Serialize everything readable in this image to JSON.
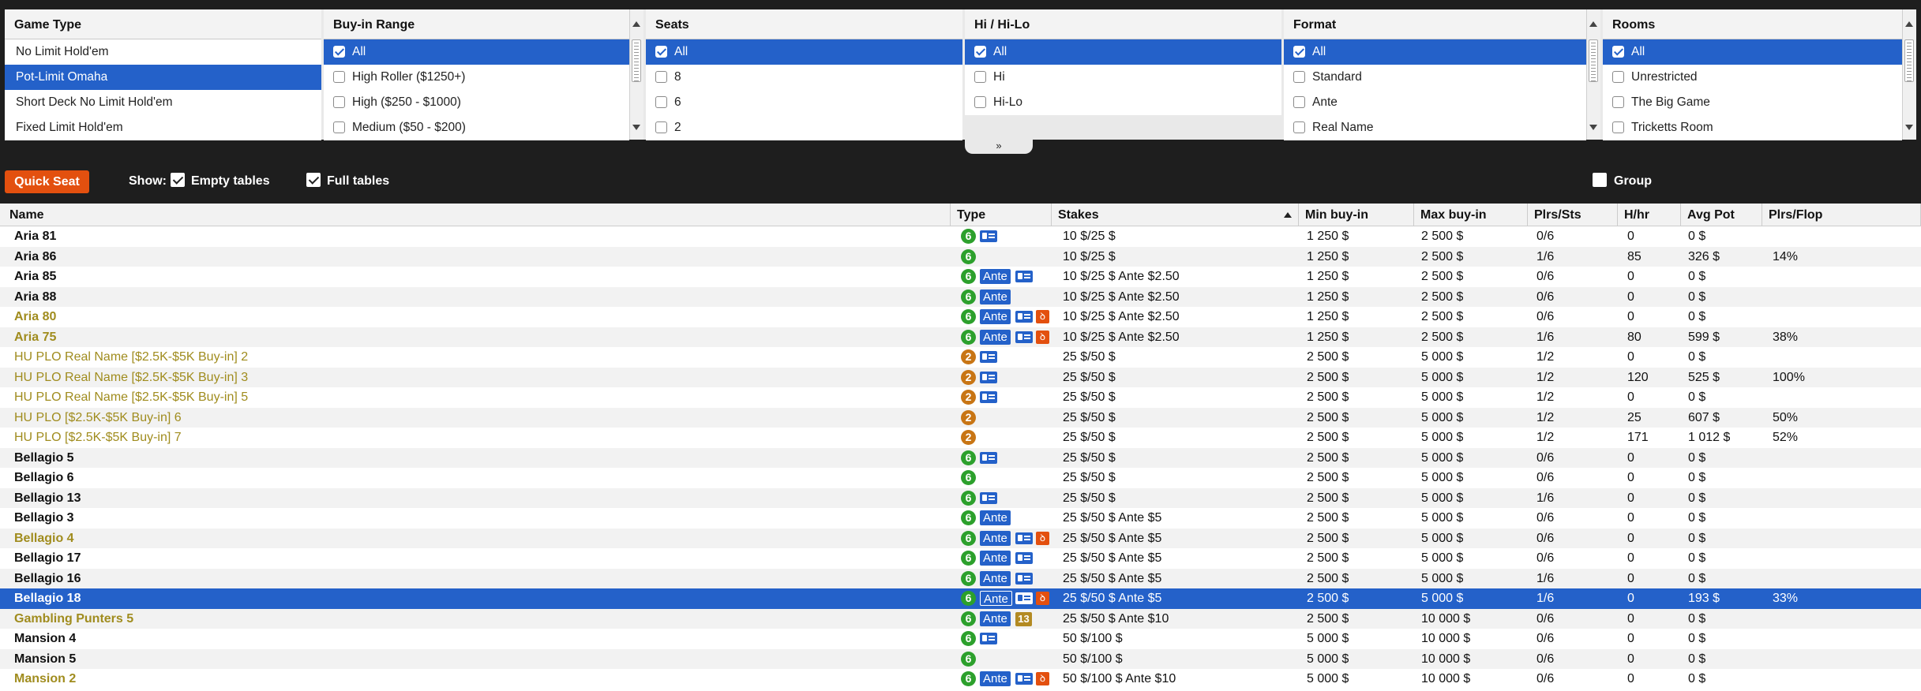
{
  "filters": {
    "game_type": {
      "title": "Game Type",
      "options": [
        "No Limit Hold'em",
        "Pot-Limit Omaha",
        "Short Deck No Limit Hold'em",
        "Fixed Limit Hold'em"
      ],
      "selected": 1
    },
    "buyin": {
      "title": "Buy-in Range",
      "options": [
        "All",
        "High Roller ($1250+)",
        "High ($250 - $1000)",
        "Medium ($50 - $200)"
      ],
      "checked": [
        true,
        false,
        false,
        false
      ]
    },
    "seats": {
      "title": "Seats",
      "options": [
        "All",
        "8",
        "6",
        "2"
      ],
      "checked": [
        true,
        false,
        false,
        false
      ]
    },
    "hilo": {
      "title": "Hi / Hi-Lo",
      "options": [
        "All",
        "Hi",
        "Hi-Lo"
      ],
      "checked": [
        true,
        false,
        false
      ]
    },
    "format": {
      "title": "Format",
      "options": [
        "All",
        "Standard",
        "Ante",
        "Real Name"
      ],
      "checked": [
        true,
        false,
        false,
        false
      ]
    },
    "rooms": {
      "title": "Rooms",
      "options": [
        "All",
        "Unrestricted",
        "The Big Game",
        "Tricketts Room"
      ],
      "checked": [
        true,
        false,
        false,
        false
      ]
    }
  },
  "collapse_glyph": "»",
  "toolbar": {
    "quick_seat": "Quick Seat",
    "show_label": "Show:",
    "empty_tables": "Empty tables",
    "empty_checked": true,
    "full_tables": "Full tables",
    "full_checked": true,
    "group": "Group",
    "group_checked": false
  },
  "columns": [
    "Name",
    "Type",
    "Stakes",
    "Min buy-in",
    "Max buy-in",
    "Plrs/Sts",
    "H/hr",
    "Avg Pot",
    "Plrs/Flop"
  ],
  "sort_column": "Stakes",
  "selected_row": 18,
  "rows": [
    {
      "name": "Aria 81",
      "style": "bold",
      "seats": "6",
      "icons": [
        "card"
      ],
      "stakes": "10 $/25 $",
      "min": "1 250 $",
      "max": "2 500 $",
      "plrs": "0/6",
      "hhr": "0",
      "avg": "0 $",
      "flop": ""
    },
    {
      "name": "Aria 86",
      "style": "bold",
      "seats": "6",
      "icons": [],
      "stakes": "10 $/25 $",
      "min": "1 250 $",
      "max": "2 500 $",
      "plrs": "1/6",
      "hhr": "85",
      "avg": "326 $",
      "flop": "14%"
    },
    {
      "name": "Aria 85",
      "style": "bold",
      "seats": "6",
      "icons": [
        "ante",
        "card"
      ],
      "stakes": "10 $/25 $ Ante $2.50",
      "min": "1 250 $",
      "max": "2 500 $",
      "plrs": "0/6",
      "hhr": "0",
      "avg": "0 $",
      "flop": ""
    },
    {
      "name": "Aria 88",
      "style": "bold",
      "seats": "6",
      "icons": [
        "ante"
      ],
      "stakes": "10 $/25 $ Ante $2.50",
      "min": "1 250 $",
      "max": "2 500 $",
      "plrs": "0/6",
      "hhr": "0",
      "avg": "0 $",
      "flop": ""
    },
    {
      "name": "Aria 80",
      "style": "gold",
      "seats": "6",
      "icons": [
        "ante",
        "card",
        "fire"
      ],
      "stakes": "10 $/25 $ Ante $2.50",
      "min": "1 250 $",
      "max": "2 500 $",
      "plrs": "0/6",
      "hhr": "0",
      "avg": "0 $",
      "flop": ""
    },
    {
      "name": "Aria 75",
      "style": "gold",
      "seats": "6",
      "icons": [
        "ante",
        "card",
        "fire"
      ],
      "stakes": "10 $/25 $ Ante $2.50",
      "min": "1 250 $",
      "max": "2 500 $",
      "plrs": "1/6",
      "hhr": "80",
      "avg": "599 $",
      "flop": "38%"
    },
    {
      "name": "HU PLO Real Name [$2.5K-$5K Buy-in] 2",
      "style": "goldn",
      "seats": "2",
      "icons": [
        "card"
      ],
      "stakes": "25 $/50 $",
      "min": "2 500 $",
      "max": "5 000 $",
      "plrs": "1/2",
      "hhr": "0",
      "avg": "0 $",
      "flop": ""
    },
    {
      "name": "HU PLO Real Name [$2.5K-$5K Buy-in] 3",
      "style": "goldn",
      "seats": "2",
      "icons": [
        "card"
      ],
      "stakes": "25 $/50 $",
      "min": "2 500 $",
      "max": "5 000 $",
      "plrs": "1/2",
      "hhr": "120",
      "avg": "525 $",
      "flop": "100%"
    },
    {
      "name": "HU PLO Real Name [$2.5K-$5K Buy-in] 5",
      "style": "goldn",
      "seats": "2",
      "icons": [
        "card"
      ],
      "stakes": "25 $/50 $",
      "min": "2 500 $",
      "max": "5 000 $",
      "plrs": "1/2",
      "hhr": "0",
      "avg": "0 $",
      "flop": ""
    },
    {
      "name": "HU PLO [$2.5K-$5K Buy-in] 6",
      "style": "goldn",
      "seats": "2",
      "icons": [],
      "stakes": "25 $/50 $",
      "min": "2 500 $",
      "max": "5 000 $",
      "plrs": "1/2",
      "hhr": "25",
      "avg": "607 $",
      "flop": "50%"
    },
    {
      "name": "HU PLO [$2.5K-$5K Buy-in] 7",
      "style": "goldn",
      "seats": "2",
      "icons": [],
      "stakes": "25 $/50 $",
      "min": "2 500 $",
      "max": "5 000 $",
      "plrs": "1/2",
      "hhr": "171",
      "avg": "1 012 $",
      "flop": "52%"
    },
    {
      "name": "Bellagio 5",
      "style": "bold",
      "seats": "6",
      "icons": [
        "card"
      ],
      "stakes": "25 $/50 $",
      "min": "2 500 $",
      "max": "5 000 $",
      "plrs": "0/6",
      "hhr": "0",
      "avg": "0 $",
      "flop": ""
    },
    {
      "name": "Bellagio 6",
      "style": "bold",
      "seats": "6",
      "icons": [],
      "stakes": "25 $/50 $",
      "min": "2 500 $",
      "max": "5 000 $",
      "plrs": "0/6",
      "hhr": "0",
      "avg": "0 $",
      "flop": ""
    },
    {
      "name": "Bellagio 13",
      "style": "bold",
      "seats": "6",
      "icons": [
        "card"
      ],
      "stakes": "25 $/50 $",
      "min": "2 500 $",
      "max": "5 000 $",
      "plrs": "1/6",
      "hhr": "0",
      "avg": "0 $",
      "flop": ""
    },
    {
      "name": "Bellagio 3",
      "style": "bold",
      "seats": "6",
      "icons": [
        "ante"
      ],
      "stakes": "25 $/50 $ Ante $5",
      "min": "2 500 $",
      "max": "5 000 $",
      "plrs": "0/6",
      "hhr": "0",
      "avg": "0 $",
      "flop": ""
    },
    {
      "name": "Bellagio 4",
      "style": "gold",
      "seats": "6",
      "icons": [
        "ante",
        "card",
        "fire"
      ],
      "stakes": "25 $/50 $ Ante $5",
      "min": "2 500 $",
      "max": "5 000 $",
      "plrs": "0/6",
      "hhr": "0",
      "avg": "0 $",
      "flop": ""
    },
    {
      "name": "Bellagio 17",
      "style": "bold",
      "seats": "6",
      "icons": [
        "ante",
        "card"
      ],
      "stakes": "25 $/50 $ Ante $5",
      "min": "2 500 $",
      "max": "5 000 $",
      "plrs": "0/6",
      "hhr": "0",
      "avg": "0 $",
      "flop": ""
    },
    {
      "name": "Bellagio 16",
      "style": "bold",
      "seats": "6",
      "icons": [
        "ante",
        "card"
      ],
      "stakes": "25 $/50 $ Ante $5",
      "min": "2 500 $",
      "max": "5 000 $",
      "plrs": "1/6",
      "hhr": "0",
      "avg": "0 $",
      "flop": ""
    },
    {
      "name": "Bellagio 18",
      "style": "bold",
      "seats": "6",
      "icons": [
        "ante",
        "card",
        "fire"
      ],
      "stakes": "25 $/50 $ Ante $5",
      "min": "2 500 $",
      "max": "5 000 $",
      "plrs": "1/6",
      "hhr": "0",
      "avg": "193 $",
      "flop": "33%"
    },
    {
      "name": "Gambling Punters 5",
      "style": "gold",
      "seats": "6",
      "icons": [
        "ante",
        "thirteen"
      ],
      "stakes": "25 $/50 $ Ante $10",
      "min": "2 500 $",
      "max": "10 000 $",
      "plrs": "0/6",
      "hhr": "0",
      "avg": "0 $",
      "flop": ""
    },
    {
      "name": "Mansion 4",
      "style": "bold",
      "seats": "6",
      "icons": [
        "card"
      ],
      "stakes": "50 $/100 $",
      "min": "5 000 $",
      "max": "10 000 $",
      "plrs": "0/6",
      "hhr": "0",
      "avg": "0 $",
      "flop": ""
    },
    {
      "name": "Mansion 5",
      "style": "bold",
      "seats": "6",
      "icons": [],
      "stakes": "50 $/100 $",
      "min": "5 000 $",
      "max": "10 000 $",
      "plrs": "0/6",
      "hhr": "0",
      "avg": "0 $",
      "flop": ""
    },
    {
      "name": "Mansion 2",
      "style": "gold",
      "seats": "6",
      "icons": [
        "ante",
        "card",
        "fire"
      ],
      "stakes": "50 $/100 $ Ante $10",
      "min": "5 000 $",
      "max": "10 000 $",
      "plrs": "0/6",
      "hhr": "0",
      "avg": "0 $",
      "flop": ""
    }
  ],
  "icon_text": {
    "ante": "Ante",
    "thirteen": "13",
    "fire": "ꝺ"
  },
  "colors": {
    "selection": "#2461c9",
    "accent_orange": "#e3500f",
    "seat_green": "#2ca02c",
    "seat_orange": "#c87514",
    "room_gold": "#a08c1e"
  }
}
